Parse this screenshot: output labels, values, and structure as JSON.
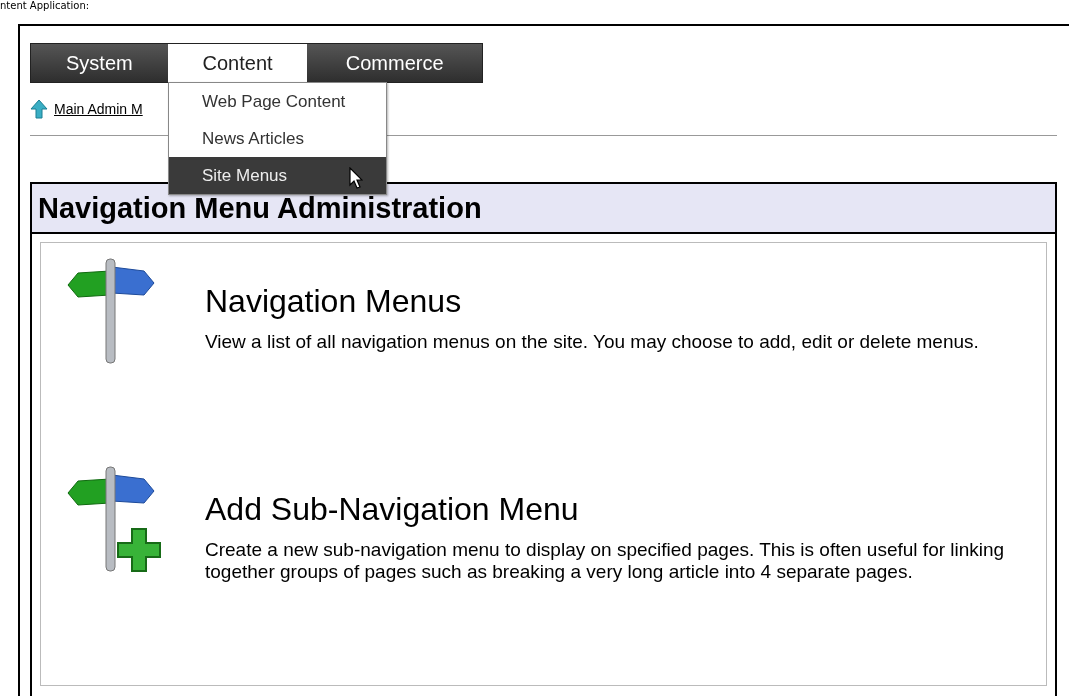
{
  "page_heading": "ntent Application:",
  "menu_bar": {
    "tabs": [
      {
        "label": "System",
        "selected": false
      },
      {
        "label": "Content",
        "selected": true
      },
      {
        "label": "Commerce",
        "selected": false
      }
    ]
  },
  "dropdown": {
    "items": [
      {
        "label": "Web Page Content",
        "selected": false
      },
      {
        "label": "News Articles",
        "selected": false
      },
      {
        "label": "Site Menus",
        "selected": true
      }
    ]
  },
  "back_link": {
    "label": "Main Admin M"
  },
  "panel": {
    "title": "Navigation Menu Administration",
    "items": [
      {
        "kind": "list",
        "title": "Navigation Menus",
        "description": "View a list of all navigation menus on the site. You may choose to add, edit or delete menus."
      },
      {
        "kind": "add",
        "title": "Add Sub-Navigation Menu",
        "description": "Create a new sub-navigation menu to display on specified pages. This is often useful for linking together groups of pages such as breaking a very long article into 4 separate pages."
      }
    ]
  }
}
